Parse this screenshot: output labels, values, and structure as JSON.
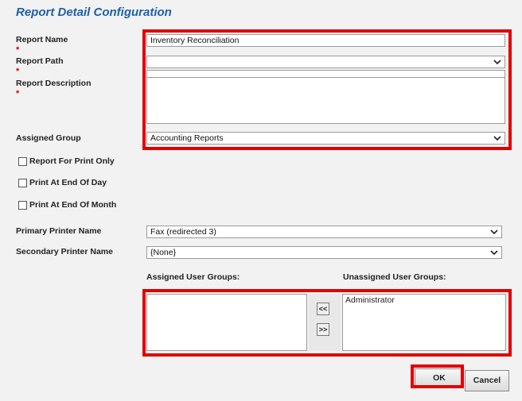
{
  "title": "Report Detail Configuration",
  "required_marker": "*",
  "fields": {
    "report_name": {
      "label": "Report Name",
      "value": "Inventory Reconciliation"
    },
    "report_path": {
      "label": "Report Path",
      "value": ""
    },
    "report_description": {
      "label": "Report Description",
      "value": ""
    },
    "assigned_group": {
      "label": "Assigned Group",
      "value": "Accounting Reports"
    },
    "primary_printer": {
      "label": "Primary Printer Name",
      "value": "Fax (redirected 3)"
    },
    "secondary_printer": {
      "label": "Secondary Printer Name",
      "value": "{None}"
    }
  },
  "checkboxes": [
    {
      "label": "Report For Print Only",
      "checked": false
    },
    {
      "label": "Print At End Of Day",
      "checked": false
    },
    {
      "label": "Print At End Of Month",
      "checked": false
    }
  ],
  "user_groups": {
    "assigned_label": "Assigned User Groups:",
    "unassigned_label": "Unassigned User Groups:",
    "assigned": [],
    "unassigned": [
      "Administrator"
    ],
    "move_left_label": "<<",
    "move_right_label": ">>"
  },
  "buttons": {
    "ok": "OK",
    "cancel": "Cancel"
  },
  "colors": {
    "title": "#1f5fa8",
    "highlight": "#e00000",
    "required": "#e00000"
  }
}
